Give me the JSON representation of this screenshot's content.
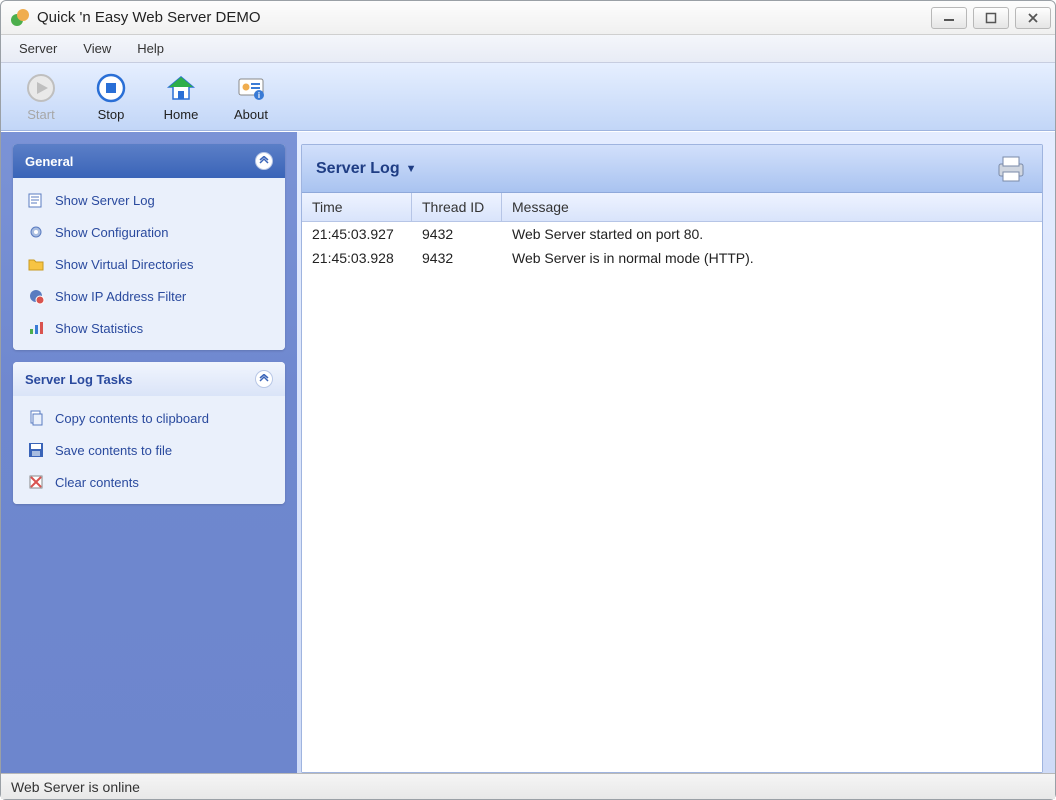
{
  "window": {
    "title": "Quick 'n Easy Web Server DEMO"
  },
  "menubar": {
    "items": [
      "Server",
      "View",
      "Help"
    ]
  },
  "toolbar": {
    "start": "Start",
    "stop": "Stop",
    "home": "Home",
    "about": "About"
  },
  "sidebar": {
    "general": {
      "title": "General",
      "items": [
        {
          "label": "Show Server Log"
        },
        {
          "label": "Show Configuration"
        },
        {
          "label": "Show Virtual Directories"
        },
        {
          "label": "Show IP Address Filter"
        },
        {
          "label": "Show Statistics"
        }
      ]
    },
    "tasks": {
      "title": "Server Log Tasks",
      "items": [
        {
          "label": "Copy contents to clipboard"
        },
        {
          "label": "Save contents to file"
        },
        {
          "label": "Clear contents"
        }
      ]
    }
  },
  "main": {
    "title": "Server Log",
    "columns": {
      "time": "Time",
      "thread": "Thread ID",
      "message": "Message"
    },
    "rows": [
      {
        "time": "21:45:03.927",
        "thread": "9432",
        "message": "Web Server started on port 80."
      },
      {
        "time": "21:45:03.928",
        "thread": "9432",
        "message": "Web Server is in normal mode (HTTP)."
      }
    ]
  },
  "status": {
    "text": "Web Server is online"
  }
}
